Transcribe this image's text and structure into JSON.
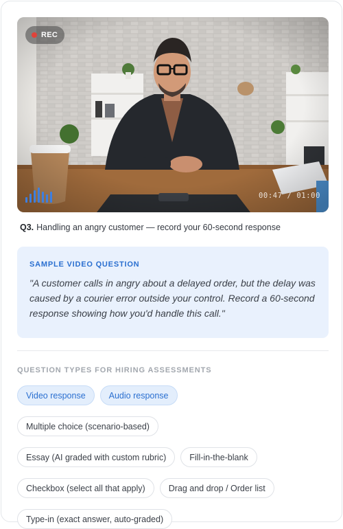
{
  "video": {
    "rec_label": "REC",
    "timer": "00:47 / 01:00"
  },
  "question": {
    "number": "Q3.",
    "text": "Handling an angry customer — record your 60-second response"
  },
  "sample": {
    "title": "SAMPLE VIDEO QUESTION",
    "text": "\"A customer calls in angry about a delayed order, but the delay was caused by a courier error outside your control. Record a 60-second response showing how you'd handle this call.\""
  },
  "question_types": {
    "heading": "QUESTION TYPES FOR HIRING ASSESSMENTS",
    "chips": [
      "Video response",
      "Audio response",
      "Multiple choice (scenario-based)",
      "Essay (AI graded with custom rubric)",
      "Fill-in-the-blank",
      "Checkbox (select all that apply)",
      "Drag and drop / Order list",
      "Type-in (exact answer, auto-graded)"
    ]
  },
  "colors": {
    "accent": "#2a6fd0",
    "accent_bg": "#e9f1fd",
    "rec": "#e0433a"
  }
}
